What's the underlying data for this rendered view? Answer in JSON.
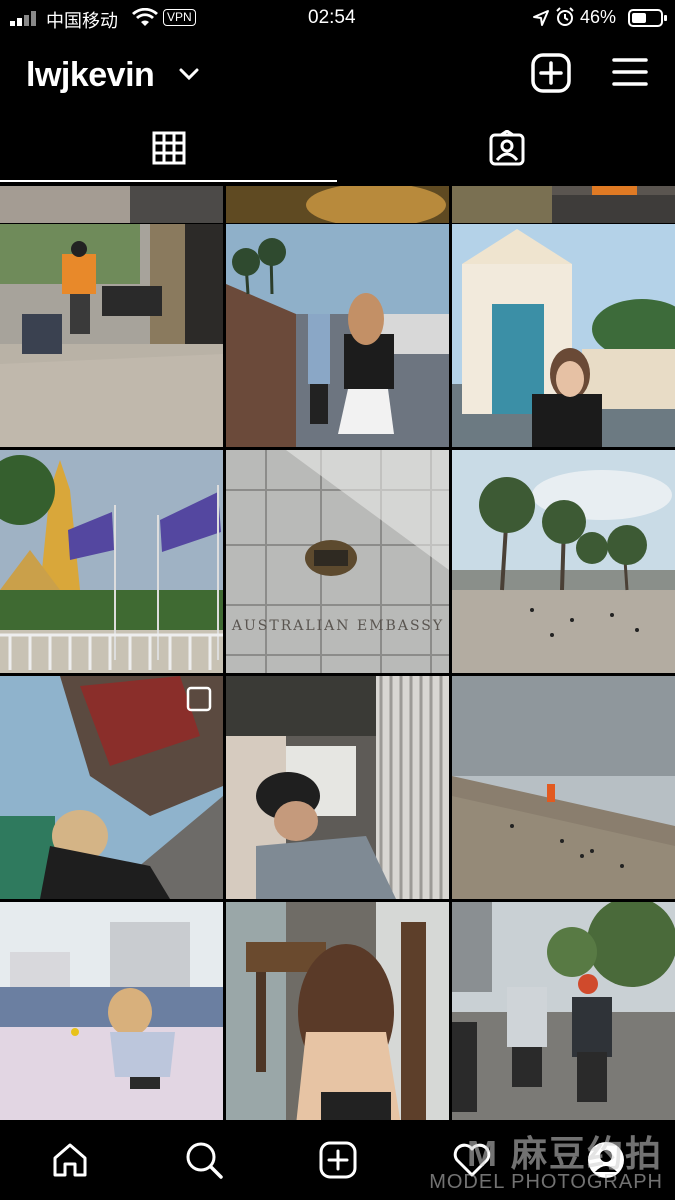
{
  "status_bar": {
    "carrier": "中国移动",
    "vpn": "VPN",
    "time": "02:54",
    "battery": "46%"
  },
  "header": {
    "username": "lwjkevin"
  },
  "tabs": [
    {
      "icon": "grid-icon",
      "active": true
    },
    {
      "icon": "tagged-icon",
      "active": false
    }
  ],
  "photos": [
    {
      "caption": "AUSTRALIAN EMBASSY"
    }
  ],
  "bottom_nav": [
    {
      "icon": "home-icon"
    },
    {
      "icon": "search-icon"
    },
    {
      "icon": "add-post-icon"
    },
    {
      "icon": "activity-heart-icon"
    },
    {
      "icon": "profile-icon"
    }
  ],
  "watermark": {
    "line1": "M 麻豆约拍",
    "line2": "MODEL PHOTOGRAPH"
  },
  "colors": {
    "background": "#000000",
    "foreground": "#ffffff"
  }
}
